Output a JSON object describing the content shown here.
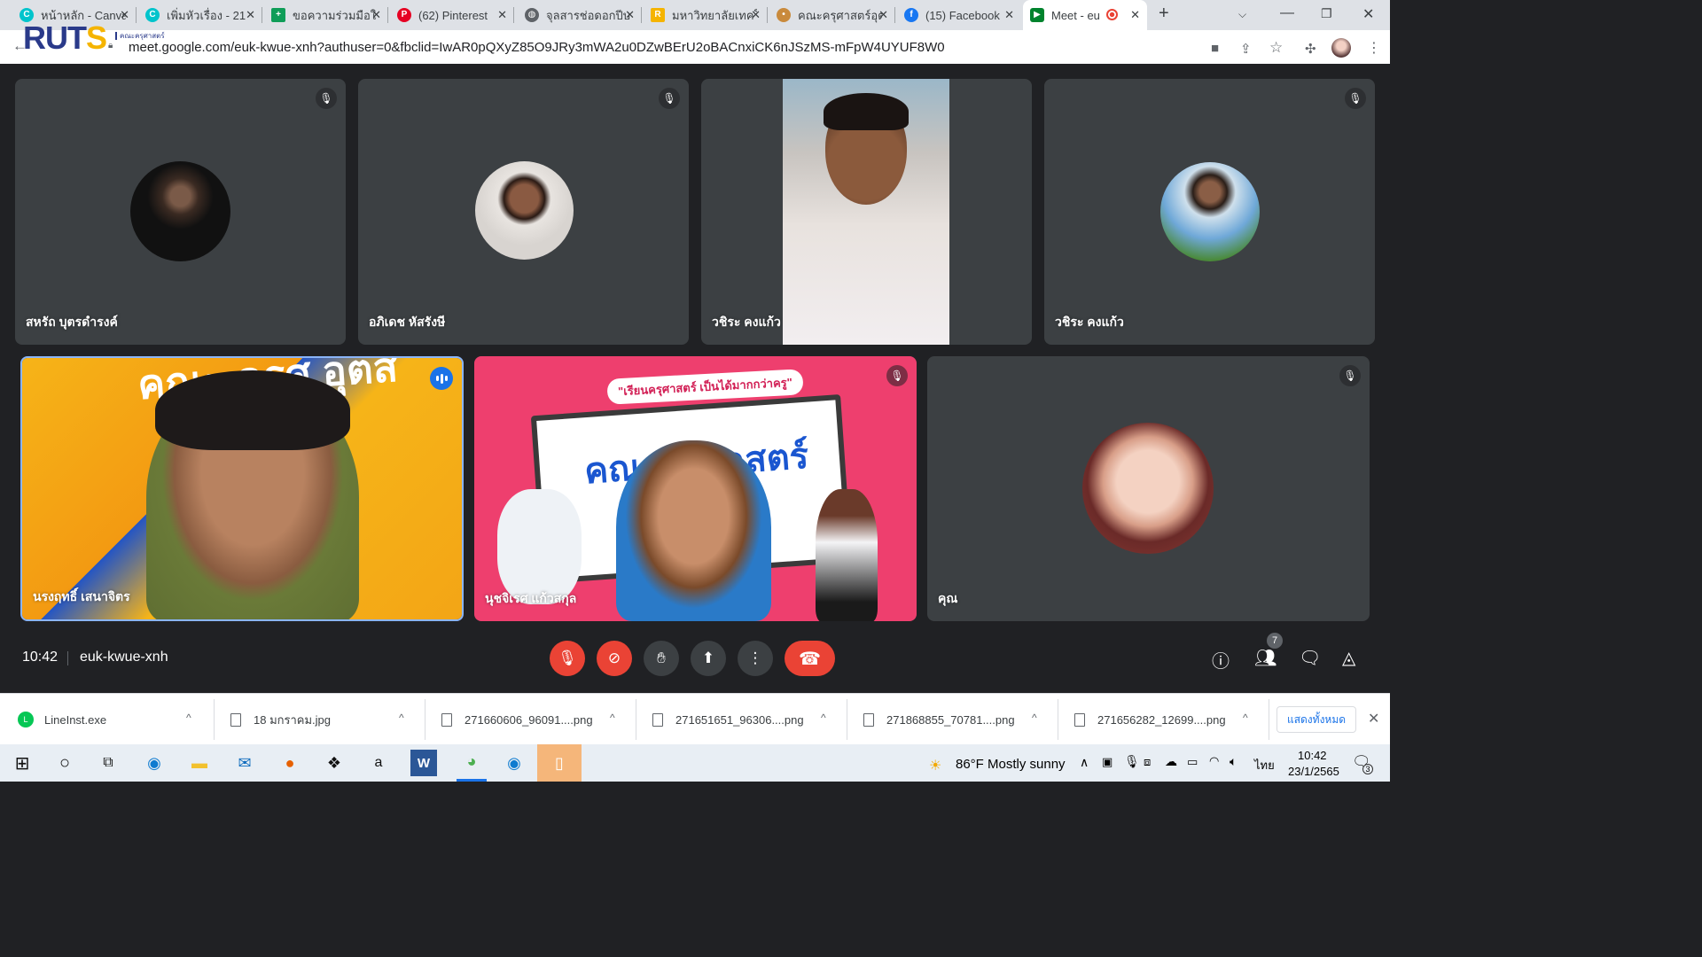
{
  "browser": {
    "tabs": [
      {
        "title": "หน้าหลัก - Canva",
        "icon": "canva-icon"
      },
      {
        "title": "เพิ่มหัวเรื่อง - 21",
        "icon": "canva-icon"
      },
      {
        "title": "ขอความร่วมมือใน",
        "icon": "sheets-icon"
      },
      {
        "title": "(62) Pinterest",
        "icon": "pinterest-icon"
      },
      {
        "title": "จุลสารช่อดอกปีบ",
        "icon": "web-icon"
      },
      {
        "title": "มหาวิทยาลัยเทคโ",
        "icon": "web-icon"
      },
      {
        "title": "คณะครุศาสตร์อุต",
        "icon": "web-icon"
      },
      {
        "title": "(15) Facebook",
        "icon": "facebook-icon"
      },
      {
        "title": "Meet - eu",
        "icon": "meet-icon"
      }
    ],
    "url": "meet.google.com/euk-kwue-xnh?authuser=0&fbclid=IwAR0pQXyZ85O9JRy3mWA2u0DZwBErU2oBACnxiCK6nJSzMS-mFpW4UYUF8W0",
    "logo": {
      "text_main": "RUT",
      "text_accent": "S",
      "subtext": "คณะครุศาสตร์"
    }
  },
  "meet": {
    "participants": [
      {
        "name": "สหรัถ บุตรดำรงค์",
        "muted": true
      },
      {
        "name": "อภิเดช หัสรังษี",
        "muted": true
      },
      {
        "name": "วชิระ คงแก้ว",
        "muted": false
      },
      {
        "name": "วชิระ คงแก้ว",
        "muted": true
      },
      {
        "name": "นรงฤทธิ์ เสนาจิตร",
        "muted": false
      },
      {
        "name": "นุชจิเรศ แก้วสกุล",
        "muted": true
      },
      {
        "name": "คุณ",
        "muted": true
      }
    ],
    "time": "10:42",
    "meeting_code": "euk-kwue-xnh",
    "people_count": "7",
    "banner_text": {
      "slogan": "\"เรียนครุศาสตร์ เป็นได้มากกว่าครู\"",
      "headline": "คณะครุศาสตร์",
      "yellow_banner": "คณะ ครุศ อุตส"
    }
  },
  "downloads": {
    "items": [
      {
        "name": "LineInst.exe"
      },
      {
        "name": "18 มกราคม.jpg"
      },
      {
        "name": "271660606_96091....png"
      },
      {
        "name": "271651651_96306....png"
      },
      {
        "name": "271868855_70781....png"
      },
      {
        "name": "271656282_12699....png"
      }
    ],
    "show_all": "แสดงทั้งหมด"
  },
  "taskbar": {
    "weather": "86°F  Mostly sunny",
    "language": "ไทย",
    "time": "10:42",
    "date": "23/1/2565",
    "notifications": "3"
  },
  "colors": {
    "meet_bg": "#202124",
    "tile_bg": "#3c4043",
    "accent_blue": "#1a73e8",
    "danger_red": "#ea4335"
  }
}
